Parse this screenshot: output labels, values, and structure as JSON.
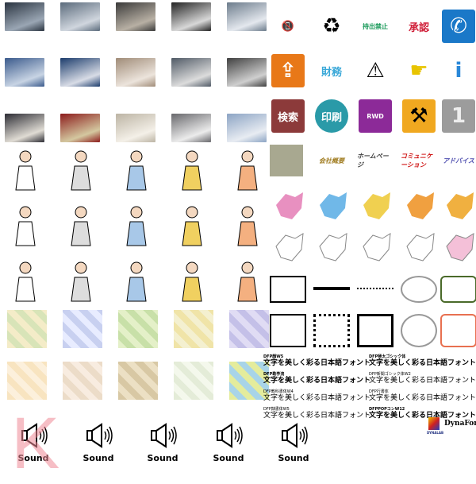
{
  "photos": [
    {
      "name": "photo-business-crowd",
      "c1": "#2a3440",
      "c2": "#9aa6b4"
    },
    {
      "name": "photo-crosswalk",
      "c1": "#5b6b7c",
      "c2": "#d0d6de"
    },
    {
      "name": "photo-office-people",
      "c1": "#3a3a3a",
      "c2": "#b8b0a4"
    },
    {
      "name": "photo-businessmen",
      "c1": "#222",
      "c2": "#d8d8d8"
    },
    {
      "name": "photo-atrium",
      "c1": "#6c7c8c",
      "c2": "#e4e8ee"
    },
    {
      "name": "photo-computer-work",
      "c1": "#3a5a8c",
      "c2": "#c8d4e4"
    },
    {
      "name": "photo-meeting",
      "c1": "#1c3c6c",
      "c2": "#d8dce6"
    },
    {
      "name": "photo-hands-paper",
      "c1": "#a08c78",
      "c2": "#ece4dc"
    },
    {
      "name": "photo-handshake",
      "c1": "#505a66",
      "c2": "#dcdcdc"
    },
    {
      "name": "photo-business-card",
      "c1": "#404040",
      "c2": "#cfcfcf"
    },
    {
      "name": "photo-writing",
      "c1": "#2c2c34",
      "c2": "#e0dcd4"
    },
    {
      "name": "photo-passport-money",
      "c1": "#8c1c1c",
      "c2": "#d4c8a0"
    },
    {
      "name": "photo-notebook-pen",
      "c1": "#bcb4a4",
      "c2": "#f4f0e8"
    },
    {
      "name": "photo-planner",
      "c1": "#68686c",
      "c2": "#ececec"
    },
    {
      "name": "photo-airplane",
      "c1": "#8ca4c4",
      "c2": "#e8ecf2"
    }
  ],
  "illustrations": [
    "doctor-illustration",
    "laptop-illustration",
    "building-illustration",
    "jumping-woman-illustration",
    "meeting-table-illustration",
    "device-illustration",
    "waving-woman-illustration",
    "thinking-man-illustration",
    "conversation-illustration",
    "phone-man-illustration",
    "reading-man-illustration",
    "family-illustration",
    "pensive-man-illustration",
    "desk-worker-illustration",
    "standing-woman-illustration"
  ],
  "patterns": [
    {
      "c1": "#f4ecc8",
      "c2": "#d8e4b8"
    },
    {
      "c1": "#c8d0f0",
      "c2": "#e8ecff"
    },
    {
      "c1": "#e4f0c8",
      "c2": "#c8e0a8"
    },
    {
      "c1": "#f0e4a8",
      "c2": "#f4f0d0"
    },
    {
      "c1": "#e0dcf4",
      "c2": "#c4c0e8"
    },
    {
      "c1": "#f8e4c0",
      "c2": "#fcf0dc"
    },
    {
      "c1": "#ecdcc8",
      "c2": "#f8ece0"
    },
    {
      "c1": "#d8c8a4",
      "c2": "#ece0c4"
    },
    {
      "c1": "#e4ecd8",
      "c2": "#f4f8ec"
    },
    {
      "c1": "#e4ec9c",
      "c2": "#a8d4e8"
    }
  ],
  "signs": [
    {
      "name": "no-phone-icon",
      "text": "📵",
      "bg": "#fff",
      "fg": "#c00"
    },
    {
      "name": "recycle-icon",
      "text": "♻",
      "bg": "#fff",
      "fg": "#000"
    },
    {
      "name": "no-takeout-stamp",
      "text": "持出禁止",
      "bg": "#fff",
      "fg": "#1a9a5a"
    },
    {
      "name": "approved-stamp",
      "text": "承認",
      "bg": "#fff",
      "fg": "#d0203a"
    },
    {
      "name": "phone-icon",
      "text": "✆",
      "bg": "#1a78c8",
      "fg": "#fff"
    },
    {
      "name": "exit-sign-icon",
      "text": "⇪",
      "bg": "#e87818",
      "fg": "#fff"
    },
    {
      "name": "finance-stamp",
      "text": "財務",
      "bg": "#fff",
      "fg": "#3aa8d8"
    },
    {
      "name": "warning-icon",
      "text": "⚠",
      "bg": "#fff",
      "fg": "#000"
    },
    {
      "name": "pointing-hand-icon",
      "text": "☛",
      "bg": "#fff",
      "fg": "#e8c400"
    },
    {
      "name": "info-icon",
      "text": "i",
      "bg": "#fff",
      "fg": "#2a88d8"
    },
    {
      "name": "search-button",
      "text": "検索",
      "bg": "#8c3a3a",
      "fg": "#fff"
    },
    {
      "name": "print-button",
      "text": "印刷",
      "bg": "#2a9aa8",
      "fg": "#fff"
    },
    {
      "name": "rewind-button",
      "text": "RWD",
      "bg": "#8c2a98",
      "fg": "#fff"
    },
    {
      "name": "construction-sign-icon",
      "text": "⚒",
      "bg": "#f0a820",
      "fg": "#000"
    },
    {
      "name": "number-one-icon",
      "text": "1",
      "bg": "#9c9c9c",
      "fg": "#eee"
    }
  ],
  "banners": [
    {
      "name": "monitor-button",
      "text": "",
      "bg": "#a8a890",
      "fg": "#666"
    },
    {
      "name": "banner-gold",
      "text": "会社概要",
      "bg": "#fff",
      "fg": "#a07c20"
    },
    {
      "name": "banner-home",
      "text": "ホームページ",
      "bg": "#fff",
      "fg": "#444"
    },
    {
      "name": "banner-communication",
      "text": "コミュニケーション",
      "bg": "#fff",
      "fg": "#d01818"
    },
    {
      "name": "banner-advice",
      "text": "アドバイス",
      "bg": "#fff",
      "fg": "#5050b0"
    }
  ],
  "maps": [
    {
      "name": "map-region-pink",
      "color": "#e890c0"
    },
    {
      "name": "map-region-blue",
      "color": "#70b8e8"
    },
    {
      "name": "map-region-yellow",
      "color": "#f0d050"
    },
    {
      "name": "map-region-orange",
      "color": "#f0a040"
    },
    {
      "name": "map-region-gold",
      "color": "#f0b040"
    },
    {
      "name": "map-outline-1",
      "color": "#ffffff"
    },
    {
      "name": "map-outline-2",
      "color": "#ffffff"
    },
    {
      "name": "map-outline-3",
      "color": "#ffffff"
    },
    {
      "name": "map-outline-4",
      "color": "#ffffff"
    },
    {
      "name": "map-japan",
      "color": "#f4c0d8"
    }
  ],
  "frames": [
    {
      "name": "corner-ornament",
      "color": "#000"
    },
    {
      "name": "line-ornament",
      "color": "#000"
    },
    {
      "name": "dotted-line",
      "color": "#000"
    },
    {
      "name": "speech-bubble-frame",
      "color": "#999"
    },
    {
      "name": "floral-frame",
      "color": "#4a6a2a"
    },
    {
      "name": "black-frame",
      "color": "#000"
    },
    {
      "name": "dotted-frame",
      "color": "#000"
    },
    {
      "name": "lace-corner",
      "color": "#000"
    },
    {
      "name": "stamp-frame",
      "color": "#999"
    },
    {
      "name": "brush-frame",
      "color": "#e87050"
    }
  ],
  "fonts": [
    {
      "label": "DFP顏W5",
      "sample": "文字を美しく彩る日本語フォント",
      "weight": "bold"
    },
    {
      "label": "DFP極太ゴシック体",
      "sample": "文字を美しく彩る日本語フォント",
      "weight": "bold"
    },
    {
      "label": "DFP勘亭流",
      "sample": "文字を美しく彩る日本語フォント",
      "weight": "bold"
    },
    {
      "label": "DFP新聞ゴシック体W2",
      "sample": "文字を美しく彩る日本語フォント",
      "weight": "normal"
    },
    {
      "label": "DFP教科書体W4",
      "sample": "文字を美しく彩る日本語フォント",
      "weight": "normal"
    },
    {
      "label": "DFP行書体",
      "sample": "文字を美しく彩る日本語フォント",
      "weight": "normal"
    },
    {
      "label": "DFP隷書体W5",
      "sample": "文字を美しく彩る日本語フォント",
      "weight": "normal"
    },
    {
      "label": "DFPPOPコンW12",
      "sample": "文字を美しく彩る日本語フォント",
      "weight": "bold"
    }
  ],
  "logo": {
    "brand": "DynaFont",
    "company": "DYNALAB"
  },
  "sounds": [
    "Sound",
    "Sound",
    "Sound",
    "Sound",
    "Sound"
  ],
  "watermark": "K"
}
